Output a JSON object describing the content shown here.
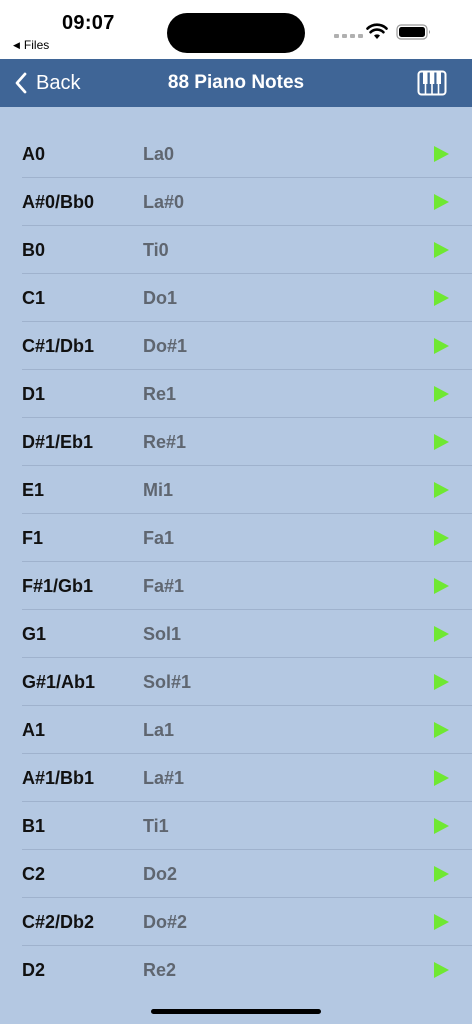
{
  "status_bar": {
    "time": "09:07",
    "back_app_label": "Files"
  },
  "nav": {
    "back_label": "Back",
    "title": "88 Piano Notes",
    "bar_color": "#3f6596"
  },
  "notes": [
    {
      "name": "A0",
      "solfege": "La0"
    },
    {
      "name": "A#0/Bb0",
      "solfege": "La#0"
    },
    {
      "name": "B0",
      "solfege": "Ti0"
    },
    {
      "name": "C1",
      "solfege": "Do1"
    },
    {
      "name": "C#1/Db1",
      "solfege": "Do#1"
    },
    {
      "name": "D1",
      "solfege": "Re1"
    },
    {
      "name": "D#1/Eb1",
      "solfege": "Re#1"
    },
    {
      "name": "E1",
      "solfege": "Mi1"
    },
    {
      "name": "F1",
      "solfege": "Fa1"
    },
    {
      "name": "F#1/Gb1",
      "solfege": "Fa#1"
    },
    {
      "name": "G1",
      "solfege": "Sol1"
    },
    {
      "name": "G#1/Ab1",
      "solfege": "Sol#1"
    },
    {
      "name": "A1",
      "solfege": "La1"
    },
    {
      "name": "A#1/Bb1",
      "solfege": "La#1"
    },
    {
      "name": "B1",
      "solfege": "Ti1"
    },
    {
      "name": "C2",
      "solfege": "Do2"
    },
    {
      "name": "C#2/Db2",
      "solfege": "Do#2"
    },
    {
      "name": "D2",
      "solfege": "Re2"
    }
  ],
  "colors": {
    "background": "#b4c8e2",
    "play_icon": "#6fe832"
  },
  "icons": {
    "back": "chevron-left-icon",
    "keyboard": "piano-keyboard-icon",
    "play": "play-icon"
  }
}
